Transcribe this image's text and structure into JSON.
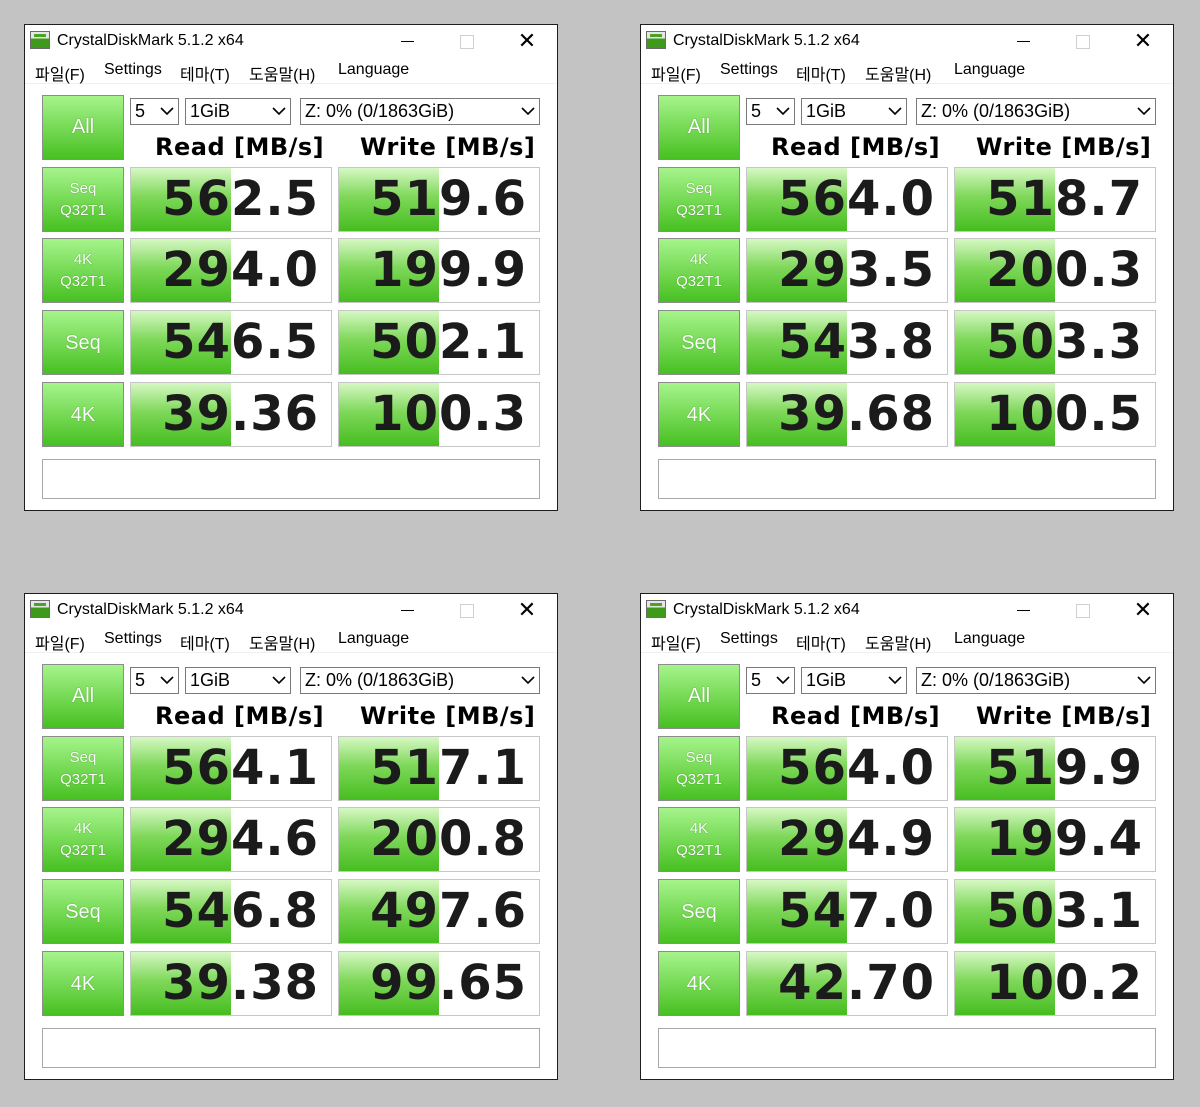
{
  "windows": [
    {
      "title": "CrystalDiskMark 5.1.2 x64",
      "menu": [
        "파일(F)",
        "Settings",
        "테마(T)",
        "도움말(H)",
        "Language"
      ],
      "all_label": "All",
      "count": "5",
      "size": "1GiB",
      "drive": "Z: 0% (0/1863GiB)",
      "read_header": "Read [MB/s]",
      "write_header": "Write [MB/s]",
      "rows": [
        {
          "label1": "Seq",
          "label2": "Q32T1",
          "read": "562.5",
          "write": "519.6",
          "read_fill": 0.5,
          "write_fill": 0.5
        },
        {
          "label1": "4K",
          "label2": "Q32T1",
          "read": "294.0",
          "write": "199.9",
          "read_fill": 0.5,
          "write_fill": 0.5
        },
        {
          "label1": "Seq",
          "label2": "",
          "read": "546.5",
          "write": "502.1",
          "read_fill": 0.5,
          "write_fill": 0.5
        },
        {
          "label1": "4K",
          "label2": "",
          "read": "39.36",
          "write": "100.3",
          "read_fill": 0.5,
          "write_fill": 0.5
        }
      ],
      "status": ""
    },
    {
      "title": "CrystalDiskMark 5.1.2 x64",
      "menu": [
        "파일(F)",
        "Settings",
        "테마(T)",
        "도움말(H)",
        "Language"
      ],
      "all_label": "All",
      "count": "5",
      "size": "1GiB",
      "drive": "Z: 0% (0/1863GiB)",
      "read_header": "Read [MB/s]",
      "write_header": "Write [MB/s]",
      "rows": [
        {
          "label1": "Seq",
          "label2": "Q32T1",
          "read": "564.0",
          "write": "518.7",
          "read_fill": 0.5,
          "write_fill": 0.5
        },
        {
          "label1": "4K",
          "label2": "Q32T1",
          "read": "293.5",
          "write": "200.3",
          "read_fill": 0.5,
          "write_fill": 0.5
        },
        {
          "label1": "Seq",
          "label2": "",
          "read": "543.8",
          "write": "503.3",
          "read_fill": 0.5,
          "write_fill": 0.5
        },
        {
          "label1": "4K",
          "label2": "",
          "read": "39.68",
          "write": "100.5",
          "read_fill": 0.5,
          "write_fill": 0.5
        }
      ],
      "status": ""
    },
    {
      "title": "CrystalDiskMark 5.1.2 x64",
      "menu": [
        "파일(F)",
        "Settings",
        "테마(T)",
        "도움말(H)",
        "Language"
      ],
      "all_label": "All",
      "count": "5",
      "size": "1GiB",
      "drive": "Z: 0% (0/1863GiB)",
      "read_header": "Read [MB/s]",
      "write_header": "Write [MB/s]",
      "rows": [
        {
          "label1": "Seq",
          "label2": "Q32T1",
          "read": "564.1",
          "write": "517.1",
          "read_fill": 0.5,
          "write_fill": 0.5
        },
        {
          "label1": "4K",
          "label2": "Q32T1",
          "read": "294.6",
          "write": "200.8",
          "read_fill": 0.5,
          "write_fill": 0.5
        },
        {
          "label1": "Seq",
          "label2": "",
          "read": "546.8",
          "write": "497.6",
          "read_fill": 0.5,
          "write_fill": 0.5
        },
        {
          "label1": "4K",
          "label2": "",
          "read": "39.38",
          "write": "99.65",
          "read_fill": 0.5,
          "write_fill": 0.5
        }
      ],
      "status": ""
    },
    {
      "title": "CrystalDiskMark 5.1.2 x64",
      "menu": [
        "파일(F)",
        "Settings",
        "테마(T)",
        "도움말(H)",
        "Language"
      ],
      "all_label": "All",
      "count": "5",
      "size": "1GiB",
      "drive": "Z: 0% (0/1863GiB)",
      "read_header": "Read [MB/s]",
      "write_header": "Write [MB/s]",
      "rows": [
        {
          "label1": "Seq",
          "label2": "Q32T1",
          "read": "564.0",
          "write": "519.9",
          "read_fill": 0.5,
          "write_fill": 0.5
        },
        {
          "label1": "4K",
          "label2": "Q32T1",
          "read": "294.9",
          "write": "199.4",
          "read_fill": 0.5,
          "write_fill": 0.5
        },
        {
          "label1": "Seq",
          "label2": "",
          "read": "547.0",
          "write": "503.1",
          "read_fill": 0.5,
          "write_fill": 0.5
        },
        {
          "label1": "4K",
          "label2": "",
          "read": "42.70",
          "write": "100.2",
          "read_fill": 0.5,
          "write_fill": 0.5
        }
      ],
      "status": ""
    }
  ],
  "colors": {
    "background": "#c3c3c3",
    "bar_green": "#46bd20",
    "button_green_light": "#a6f48b",
    "button_green_dark": "#47c021"
  }
}
